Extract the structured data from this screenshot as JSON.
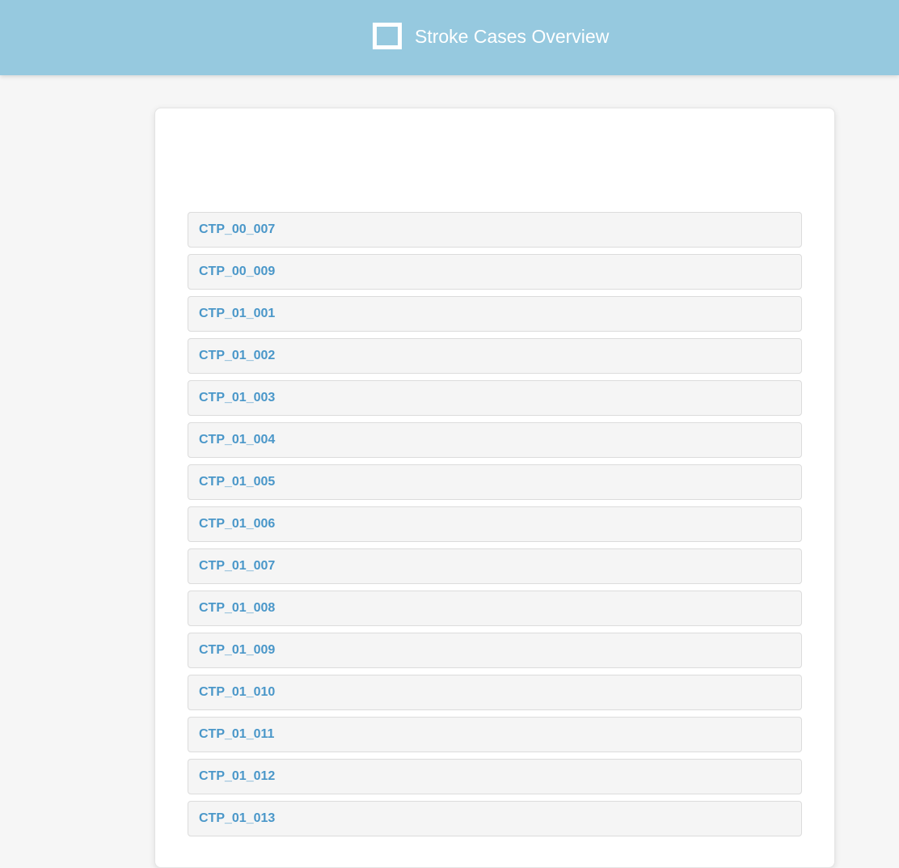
{
  "header": {
    "title": "Stroke Cases Overview",
    "icon": "square-outline-icon"
  },
  "cases": [
    {
      "id": "CTP_00_007"
    },
    {
      "id": "CTP_00_009"
    },
    {
      "id": "CTP_01_001"
    },
    {
      "id": "CTP_01_002"
    },
    {
      "id": "CTP_01_003"
    },
    {
      "id": "CTP_01_004"
    },
    {
      "id": "CTP_01_005"
    },
    {
      "id": "CTP_01_006"
    },
    {
      "id": "CTP_01_007"
    },
    {
      "id": "CTP_01_008"
    },
    {
      "id": "CTP_01_009"
    },
    {
      "id": "CTP_01_010"
    },
    {
      "id": "CTP_01_011"
    },
    {
      "id": "CTP_01_012"
    },
    {
      "id": "CTP_01_013"
    }
  ],
  "colors": {
    "header_bg": "#96c9df",
    "link": "#4a97c9",
    "item_bg": "#f5f5f5",
    "page_bg": "#f6f6f6"
  }
}
